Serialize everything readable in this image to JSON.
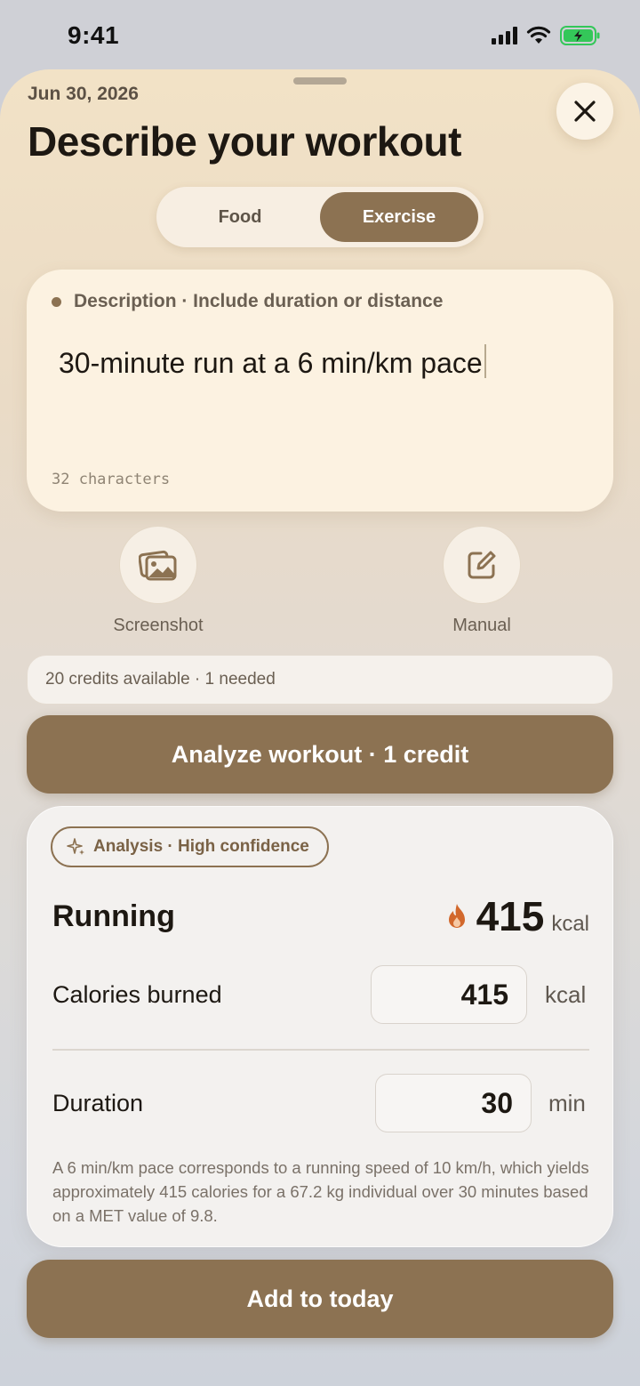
{
  "status_bar": {
    "time": "9:41"
  },
  "header": {
    "date": "Jun 30, 2026",
    "title": "Describe your workout"
  },
  "segmented": {
    "options": [
      "Food",
      "Exercise"
    ],
    "selected": "Exercise"
  },
  "description": {
    "label": "Description · Include duration or distance",
    "value": "30-minute run at a 6 min/km pace",
    "char_count": "32 characters"
  },
  "actions": {
    "screenshot_label": "Screenshot",
    "manual_label": "Manual"
  },
  "credits": {
    "text": "20 credits available · 1 needed"
  },
  "analyze_button": {
    "label": "Analyze workout · 1 credit"
  },
  "result": {
    "badge": "Analysis · High confidence",
    "activity": "Running",
    "kcal_value": "415",
    "kcal_unit": "kcal",
    "calories_label": "Calories burned",
    "calories_value": "415",
    "calories_unit": "kcal",
    "duration_label": "Duration",
    "duration_value": "30",
    "duration_unit": "min",
    "explanation": "A 6 min/km pace corresponds to a running speed of 10 km/h, which yields approximately 415 calories for a 67.2 kg individual over 30 minutes based on a MET value of 9.8."
  },
  "add_button": {
    "label": "Add to today"
  },
  "colors": {
    "accent": "#8c7252",
    "flame": "#d2682c",
    "battery": "#34c759"
  },
  "icons": [
    "close-icon",
    "image-icon",
    "edit-icon",
    "sparkle-icon",
    "flame-icon",
    "signal-icon",
    "wifi-icon",
    "battery-icon"
  ]
}
